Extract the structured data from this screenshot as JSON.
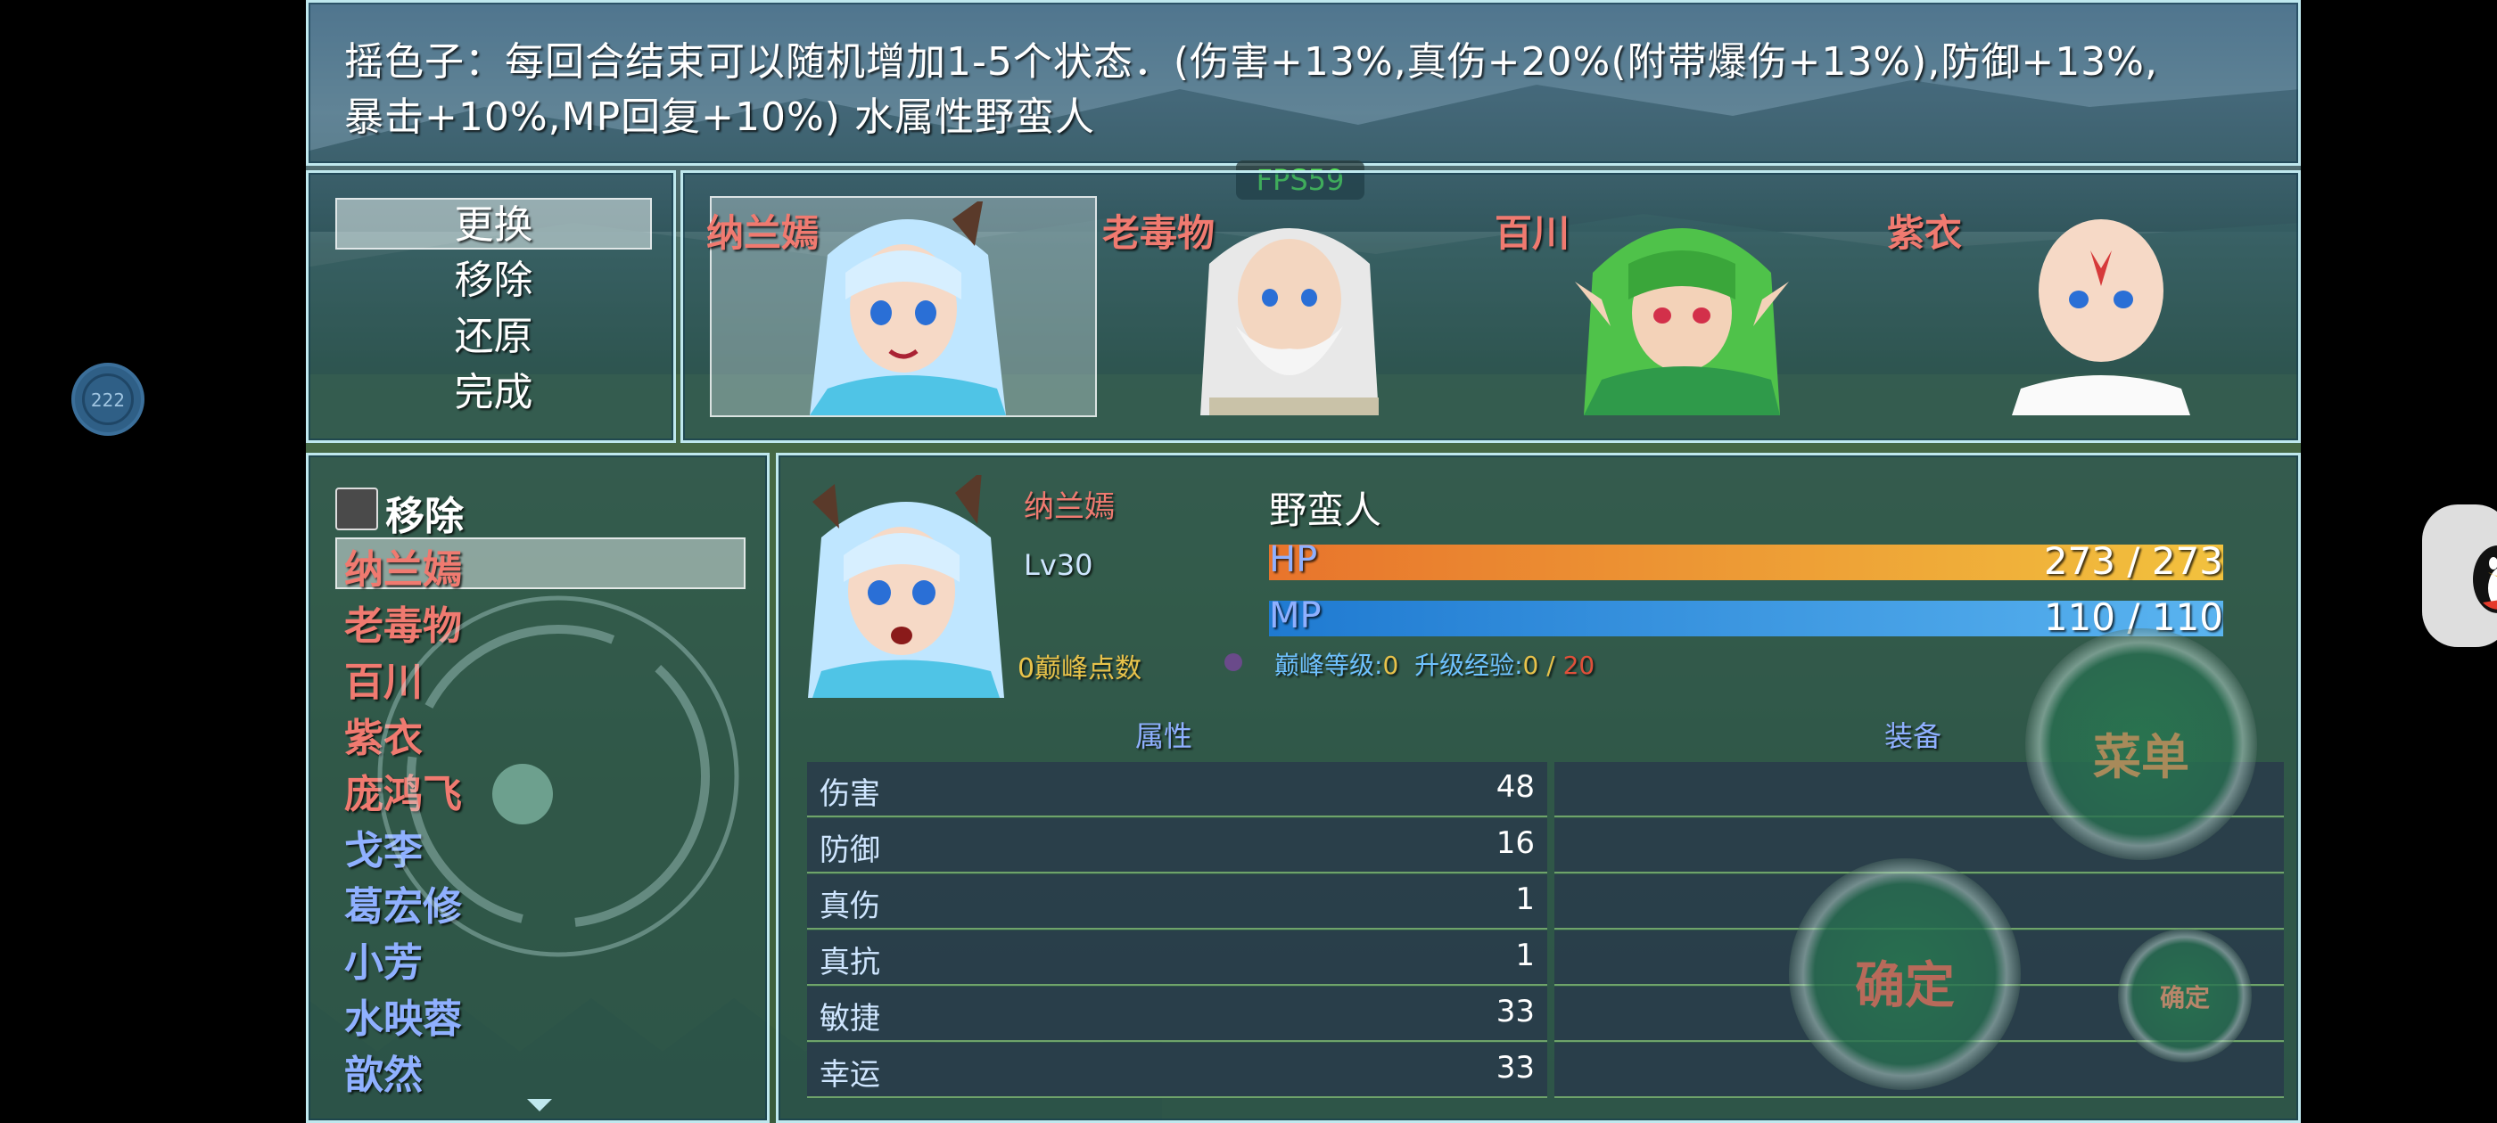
{
  "help": {
    "line1": "摇色子：每回合结束可以随机增加1-5个状态．(伤害+13%,真伤+20%(附带爆伤+13%),防御+13%,",
    "line2": "暴击+10%,MP回复+10%)      水属性野蛮人"
  },
  "fps": "FPS59",
  "floating_badge": "222",
  "commands": [
    "更换",
    "移除",
    "还原",
    "完成"
  ],
  "party": [
    {
      "name": "纳兰嫣",
      "hair": "#bfe6ff"
    },
    {
      "name": "老毒物",
      "hair": "#e8e8e8"
    },
    {
      "name": "百川",
      "hair": "#4fc24a"
    },
    {
      "name": "紫衣",
      "hair": "#f3d2b8"
    }
  ],
  "list": {
    "remove_label": "移除",
    "actors": [
      {
        "name": "纳兰嫣",
        "color": "#f07a70"
      },
      {
        "name": "老毒物",
        "color": "#f07a70"
      },
      {
        "name": "百川",
        "color": "#f07a70"
      },
      {
        "name": "紫衣",
        "color": "#f07a70"
      },
      {
        "name": "庞鸿飞",
        "color": "#f07a70"
      },
      {
        "name": "戈李",
        "color": "#8fb0ff"
      },
      {
        "name": "葛宏修",
        "color": "#8fb0ff"
      },
      {
        "name": "小芳",
        "color": "#8fb0ff"
      },
      {
        "name": "水映蓉",
        "color": "#8fb0ff"
      },
      {
        "name": "歆然",
        "color": "#8fb0ff"
      }
    ]
  },
  "status": {
    "name": "纳兰嫣",
    "level": "Lv30",
    "class": "野蛮人",
    "hp_label": "HP",
    "hp_text": "273 / 273",
    "hp_fraction": 1.0,
    "mp_label": "MP",
    "mp_text": "110 / 110",
    "mp_fraction": 1.0,
    "peak_points": "0巅峰点数",
    "peak_level_label": "巅峰等级:",
    "peak_level_value": "0",
    "upgrade_exp_label": "升级经验:",
    "upgrade_exp_value": "0",
    "upgrade_exp_sep": " / ",
    "upgrade_exp_max": "20",
    "attr_header": "属性",
    "equip_header": "装备",
    "attributes": [
      {
        "label": "伤害",
        "value": "48"
      },
      {
        "label": "防御",
        "value": "16"
      },
      {
        "label": "真伤",
        "value": "1"
      },
      {
        "label": "真抗",
        "value": "1"
      },
      {
        "label": "敏捷",
        "value": "33"
      },
      {
        "label": "幸运",
        "value": "33"
      }
    ]
  },
  "buttons": {
    "menu": "菜单",
    "confirm": "确定",
    "confirm_small": "确定"
  },
  "colors": {
    "hp_start": "#e8742c",
    "hp_end": "#f2c23e",
    "mp_start": "#1f7ad1",
    "mp_end": "#5ab4f0",
    "accent_red": "#f07a70",
    "accent_blue": "#8fb0ff",
    "peak_yellow": "#e8c24a",
    "peak_red": "#e0503a"
  }
}
